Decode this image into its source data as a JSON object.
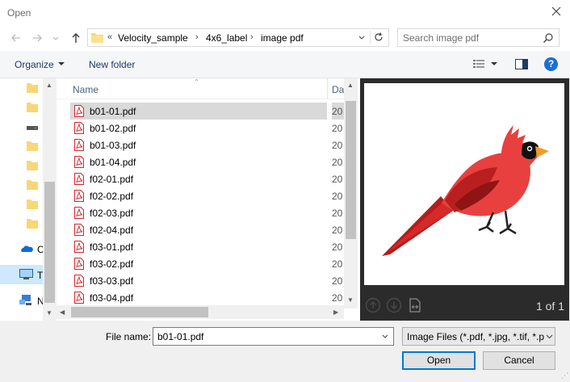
{
  "window": {
    "title": "Open"
  },
  "address": {
    "overflow": "«",
    "crumbs": [
      "Velocity_sample",
      "4x6_label",
      "image pdf"
    ]
  },
  "search": {
    "placeholder": "Search image pdf"
  },
  "toolbar": {
    "organize_label": "Organize",
    "new_folder_label": "New folder"
  },
  "nav_pane": {
    "items": [
      {
        "icon": "folder-icon",
        "label": ""
      },
      {
        "icon": "folder-icon",
        "label": ""
      },
      {
        "icon": "drive-icon",
        "label": ""
      },
      {
        "icon": "folder-icon",
        "label": ""
      },
      {
        "icon": "folder-icon",
        "label": ""
      },
      {
        "icon": "folder-icon",
        "label": ""
      },
      {
        "icon": "folder-icon",
        "label": ""
      },
      {
        "icon": "onedrive-icon",
        "label": "C"
      },
      {
        "icon": "this-pc-icon",
        "label": "T"
      },
      {
        "icon": "network-icon",
        "label": "N"
      }
    ]
  },
  "file_list": {
    "columns": {
      "name": "Name",
      "date": "Da"
    },
    "files": [
      {
        "name": "b01-01.pdf",
        "date": "20",
        "selected": true
      },
      {
        "name": "b01-02.pdf",
        "date": "20"
      },
      {
        "name": "b01-03.pdf",
        "date": "20"
      },
      {
        "name": "b01-04.pdf",
        "date": "20"
      },
      {
        "name": "f02-01.pdf",
        "date": "20"
      },
      {
        "name": "f02-02.pdf",
        "date": "20"
      },
      {
        "name": "f02-03.pdf",
        "date": "20"
      },
      {
        "name": "f02-04.pdf",
        "date": "20"
      },
      {
        "name": "f03-01.pdf",
        "date": "20"
      },
      {
        "name": "f03-02.pdf",
        "date": "20"
      },
      {
        "name": "f03-03.pdf",
        "date": "20"
      },
      {
        "name": "f03-04.pdf",
        "date": "20"
      }
    ]
  },
  "preview": {
    "page_indicator": "1 of 1",
    "subject": "cardinal-bird-image"
  },
  "footer": {
    "file_name_label": "File name:",
    "file_name_value": "b01-01.pdf",
    "file_type_value": "Image Files (*.pdf, *.jpg, *.tif, *.p",
    "open_label": "Open",
    "cancel_label": "Cancel"
  },
  "colors": {
    "accent": "#0078d7",
    "selection": "#d9d9d9",
    "pdf_red": "#d4262c",
    "cardinal": "#e8403f"
  }
}
